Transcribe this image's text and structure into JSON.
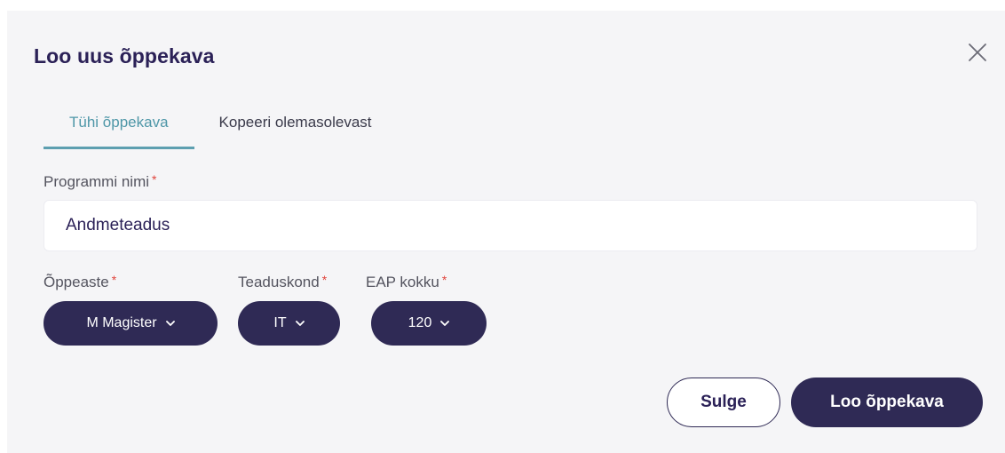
{
  "dialog": {
    "title": "Loo uus õppekava",
    "close_icon": "close-icon"
  },
  "tabs": [
    {
      "label": "Tühi õppekava",
      "active": true
    },
    {
      "label": "Kopeeri olemasolevast",
      "active": false
    }
  ],
  "program_name": {
    "label": "Programmi nimi",
    "required_mark": "*",
    "value": "Andmeteadus"
  },
  "level": {
    "label": "Õppeaste",
    "required_mark": "*",
    "value": "M Magister"
  },
  "faculty": {
    "label": "Teaduskond",
    "required_mark": "*",
    "value": "IT"
  },
  "ects": {
    "label": "EAP kokku",
    "required_mark": "*",
    "value": "120"
  },
  "actions": {
    "close_label": "Sulge",
    "create_label": "Loo õppekava"
  },
  "colors": {
    "primary": "#2f2a55",
    "accent": "#5d9fb0",
    "required": "#e0443c",
    "background": "#f5f5f7"
  }
}
